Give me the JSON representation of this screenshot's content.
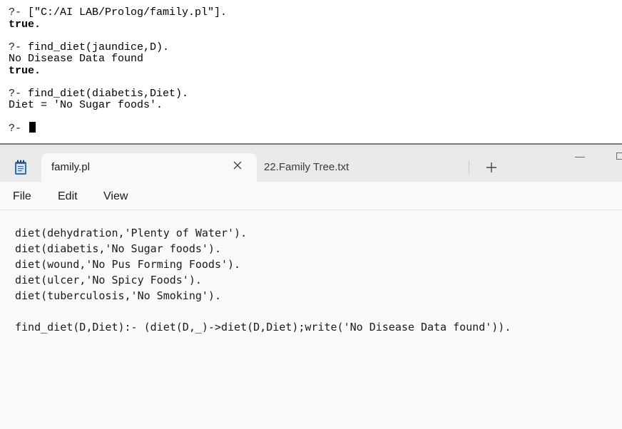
{
  "console": {
    "lines": [
      {
        "prompt": "?- ",
        "text": "[\"C:/AI LAB/Prolog/family.pl\"]."
      },
      {
        "text": "true."
      },
      {
        "prompt": "?- ",
        "text": "find_diet(jaundice,D)."
      },
      {
        "text": "No Disease Data found"
      },
      {
        "text": "true."
      },
      {
        "prompt": "?- ",
        "text": "find_diet(diabetis,Diet)."
      },
      {
        "text": "Diet = 'No Sugar foods'."
      },
      {
        "prompt": "?- ",
        "text": ""
      }
    ]
  },
  "notepad": {
    "tabs": [
      {
        "label": "family.pl",
        "active": true
      },
      {
        "label": "22.Family Tree.txt",
        "active": false
      }
    ],
    "new_tab_symbol": "+",
    "menu": [
      "File",
      "Edit",
      "View"
    ],
    "code_lines": [
      "diet(dehydration,'Plenty of Water').",
      "diet(diabetis,'No Sugar foods').",
      "diet(wound,'No Pus Forming Foods').",
      "diet(ulcer,'No Spicy Foods').",
      "diet(tuberculosis,'No Smoking').",
      "",
      "find_diet(D,Diet):- (diet(D,_)->diet(D,Diet);write('No Disease Data found'))."
    ]
  },
  "colors": {
    "tabbar_bg": "#e9e9e9",
    "editor_bg": "#f9f9f9",
    "console_bg": "#ffffff"
  },
  "icons": [
    "notepad-icon",
    "close-icon",
    "plus-icon",
    "minimize-icon",
    "maximize-icon",
    "text-cursor"
  ]
}
